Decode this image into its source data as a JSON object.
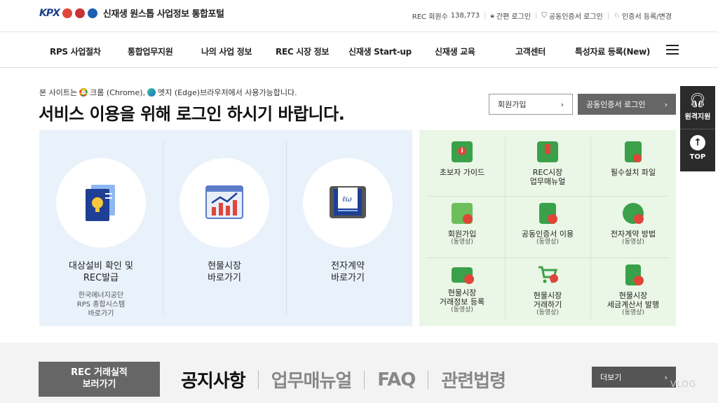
{
  "header": {
    "logo_text": "KPX",
    "site_title": "신재생 원스톱 사업정보 통합포털",
    "member_count_label": "REC 회원수",
    "member_count": "138,773",
    "simple_login": "간편 로그인",
    "cert_login": "공동인증서 로그인",
    "cert_register": "인증서 등록/변경"
  },
  "nav": {
    "items": [
      "RPS 사업절차",
      "통합업무지원",
      "나의 사업 정보",
      "REC 시장 정보",
      "신재생 Start-up",
      "신재생 교육",
      "고객센터",
      "특성자료 등록(New)"
    ]
  },
  "notice": {
    "prefix": "본 사이트는",
    "chrome": "크롬 (Chrome),",
    "edge": "엣지 (Edge)브라우저에서 사용가능합니다.",
    "headline": "서비스 이용을 위해 로그인 하시기 바랍니다."
  },
  "buttons": {
    "join": "회원가입",
    "cert_login": "공동인증서 로그인"
  },
  "services": [
    {
      "label1": "대상설비 확인 및",
      "label2": "REC발급",
      "sub1": "한국에너지공단",
      "sub2": "RPS 종합시스템",
      "sub3": "바로가기"
    },
    {
      "label1": "현물시장",
      "label2": "바로가기"
    },
    {
      "label1": "전자계약",
      "label2": "바로가기"
    }
  ],
  "guides": [
    {
      "t1": "초보자 가이드",
      "t2": "",
      "sub": ""
    },
    {
      "t1": "REC시장",
      "t2": "업무매뉴얼",
      "sub": ""
    },
    {
      "t1": "필수설치 파일",
      "t2": "",
      "sub": ""
    },
    {
      "t1": "회원가입",
      "t2": "",
      "sub": "(동영상)"
    },
    {
      "t1": "공동인증서 이용",
      "t2": "",
      "sub": "(동영상)"
    },
    {
      "t1": "전자계약 방법",
      "t2": "",
      "sub": "(동영상)"
    },
    {
      "t1": "현물시장",
      "t2": "거래정보 등록",
      "sub": "(동영상)"
    },
    {
      "t1": "현물시장",
      "t2": "거래하기",
      "sub": "(동영상)"
    },
    {
      "t1": "현물시장",
      "t2": "세금계산서 발행",
      "sub": "(동영상)"
    }
  ],
  "side": {
    "remote": "원격지원",
    "top": "TOP"
  },
  "bottom": {
    "rec_line1": "REC 거래실적",
    "rec_line2": "보러가기",
    "tabs": [
      "공지사항",
      "업무매뉴얼",
      "FAQ",
      "관련법령"
    ],
    "more": "더보기",
    "watermark": "VLOG"
  },
  "colors": {
    "green_icon": "#3aa14a",
    "red_accent": "#e0453a",
    "navy": "#1e3f94"
  }
}
